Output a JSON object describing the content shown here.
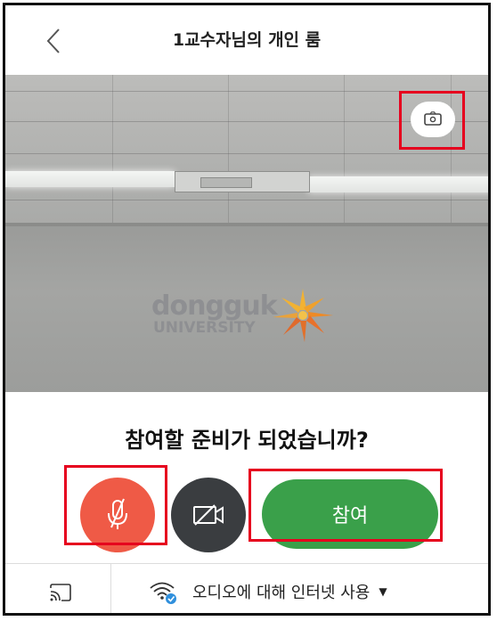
{
  "header": {
    "title": "1교수자님의 개인 룸",
    "back_icon": "chevron-left-icon"
  },
  "preview": {
    "wall_logo_name": "dongguk",
    "wall_logo_sub": "UNIVERSITY",
    "switch_camera_icon": "switch-camera-icon"
  },
  "prompt": {
    "question": "참여할 준비가 되었습니까?"
  },
  "controls": {
    "mic_icon": "mic-muted-icon",
    "video_icon": "video-off-icon",
    "join_label": "참여",
    "mic_color": "#ef5a46",
    "video_color": "#3a3d40",
    "join_color": "#3aa04a"
  },
  "footer": {
    "cast_icon": "cast-icon",
    "audio_icon": "wifi-icon",
    "audio_label": "오디오에 대해 인터넷 사용",
    "audio_caret_icon": "caret-down-icon"
  },
  "highlight_color": "#e6001e"
}
